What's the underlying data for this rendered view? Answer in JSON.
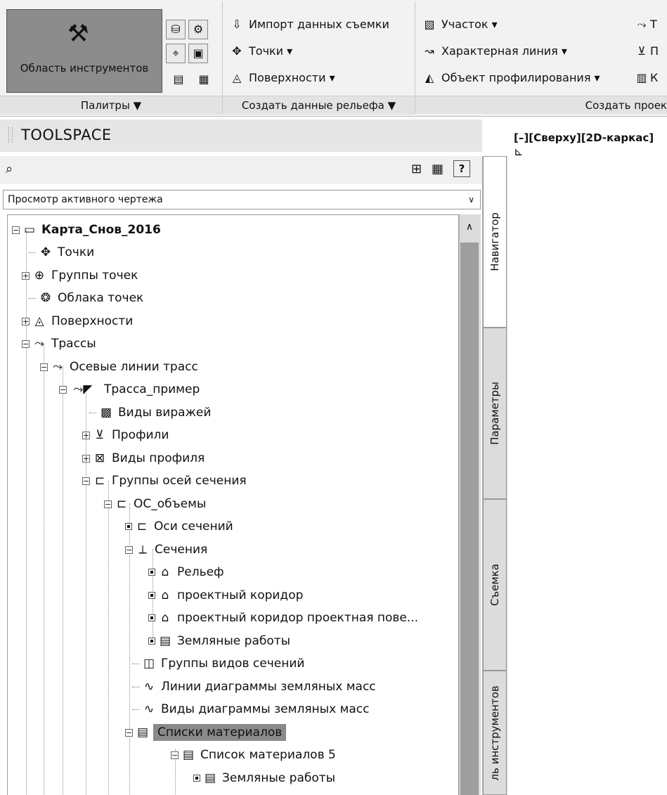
{
  "ribbon": {
    "palettes": {
      "toolspace_label": "Область инструментов",
      "panel_title": "Палитры ▼"
    },
    "create_ground_data": {
      "items": [
        "Импорт данных съемки",
        "Точки ▾",
        "Поверхности ▾"
      ],
      "panel_title": "Создать данные рельефа ▼"
    },
    "create_design": {
      "items": [
        "Участок ▾",
        "Характерная линия ▾",
        "Объект профилирования ▾"
      ],
      "right_items": [
        "Т",
        "П",
        "К"
      ],
      "panel_title": "Создать проек"
    }
  },
  "toolspace": {
    "title": "TOOLSPACE",
    "view_select": "Просмотр активного чертежа",
    "help": "?",
    "tabs": [
      "Навигатор",
      "Параметры",
      "Съемка",
      "ль инструментов"
    ]
  },
  "tree": [
    "Карта_Снов_2016",
    "Точки",
    "Группы точек",
    "Облака точек",
    "Поверхности",
    "Трассы",
    "Осевые линии трасс",
    "Трасса_пример",
    "Виды виражей",
    "Профили",
    "Виды профиля",
    "Группы осей сечения",
    "ОС_объемы",
    "Оси сечений",
    "Сечения",
    "Рельеф",
    "проектный коридор",
    "проектный коридор проектная пове...",
    "Земляные работы",
    "Группы видов сечений",
    "Линии диаграммы земляных масс",
    "Виды диаграммы земляных масс",
    "Списки материалов",
    "Список материалов 5",
    "Земляные работы"
  ],
  "viewport": {
    "label": "[–][Сверху][2D-каркас]"
  }
}
